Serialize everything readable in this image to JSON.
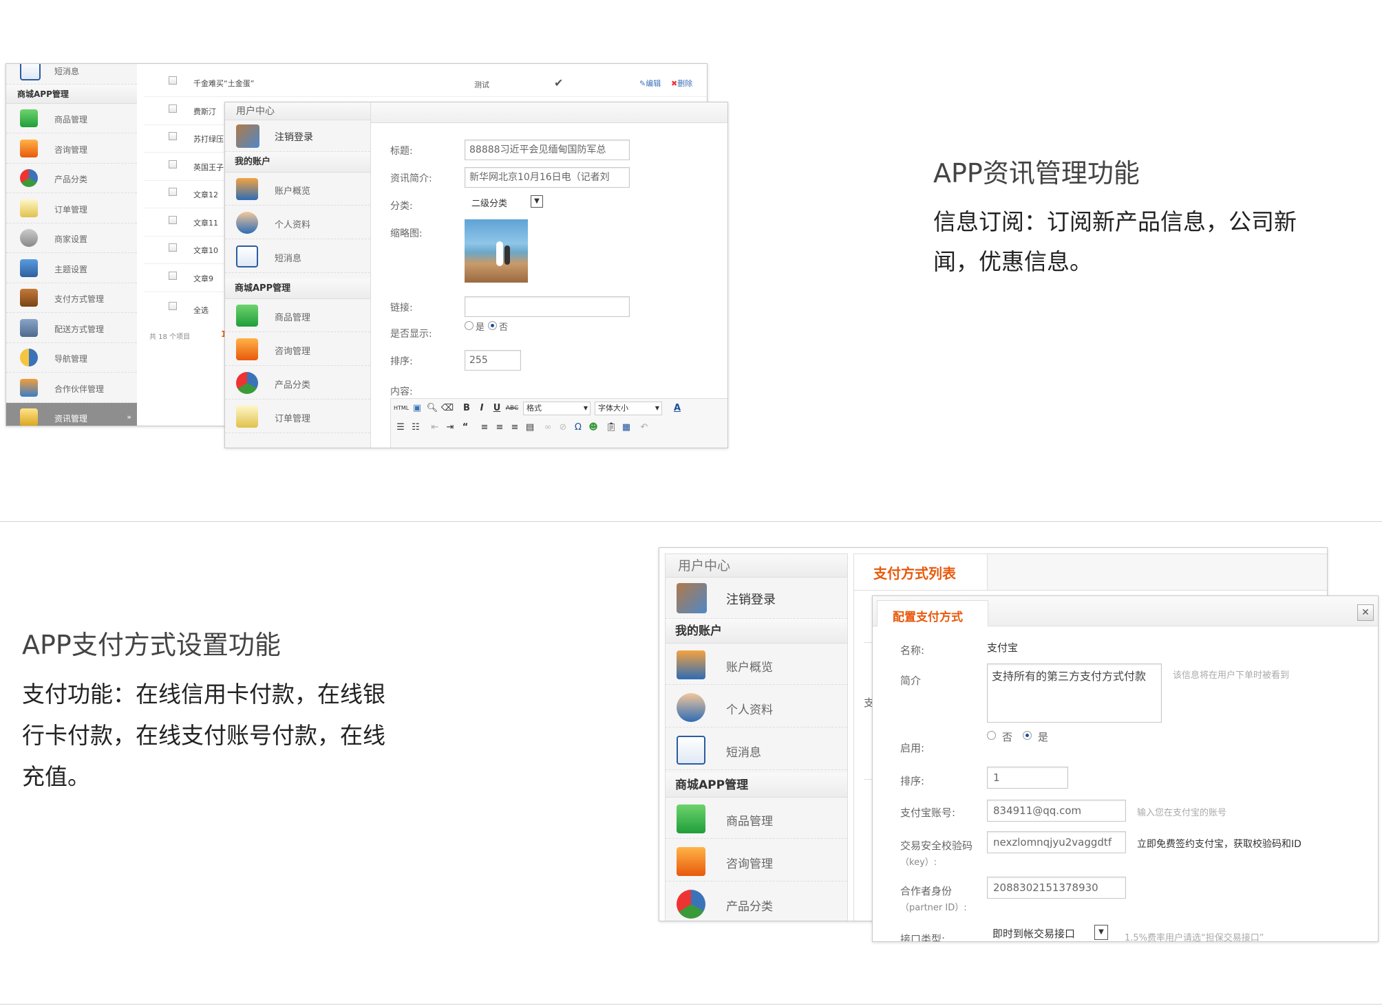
{
  "colors": {
    "accent": "#e8590c",
    "brand_blue": "#1a4f9e",
    "sidebar_active": "#8e8e8e"
  },
  "feature1": {
    "title": "APP资讯管理功能",
    "desc_line1": "信息订阅：订阅新产品信息，公司新",
    "desc_line2": "闻，优惠信息。"
  },
  "feature2": {
    "title": "APP支付方式设置功能",
    "desc_line1": "支付功能：在线信用卡付款，在线银",
    "desc_line2": "行卡付款，在线支付账号付款，在线",
    "desc_line3": "充值。"
  },
  "shot1": {
    "back": {
      "top_item": "短消息",
      "section": "商城APP管理",
      "menu": [
        "商品管理",
        "咨询管理",
        "产品分类",
        "订单管理",
        "商家设置",
        "主题设置",
        "支付方式管理",
        "配送方式管理",
        "导航管理",
        "合作伙伴管理",
        "资讯管理"
      ],
      "rows": [
        "千金难买“土金蛋”",
        "费斯汀",
        "苏打绿压",
        "英国王子",
        "文章12",
        "文章11",
        "文章10",
        "文章9"
      ],
      "row1_cat": "测试",
      "edit": "编辑",
      "del": "删除",
      "select_all": "全选",
      "pager": "共 18 个项目",
      "page": "1"
    },
    "front": {
      "header": "用户中心",
      "logout": "注销登录",
      "my_account": "我的账户",
      "account_items": [
        "账户概览",
        "个人资料",
        "短消息"
      ],
      "section": "商城APP管理",
      "shop_items": [
        "商品管理",
        "咨询管理",
        "产品分类",
        "订单管理"
      ],
      "form": {
        "title_label": "标题:",
        "title_value": "88888习近平会见缅甸国防军总",
        "summary_label": "资讯简介:",
        "summary_value": "新华网北京10月16日电（记者刘",
        "category_label": "分类:",
        "category_value": "二级分类",
        "thumb_label": "缩略图:",
        "link_label": "链接:",
        "show_label": "是否显示:",
        "yes": "是",
        "no": "否",
        "order_label": "排序:",
        "order_value": "255",
        "content_label": "内容:",
        "toolbar_format": "格式",
        "toolbar_fontsize": "字体大小"
      }
    }
  },
  "shot2": {
    "sidebar": {
      "header": "用户中心",
      "logout": "注销登录",
      "my_account": "我的账户",
      "account_items": [
        "账户概览",
        "个人资料",
        "短消息"
      ],
      "section": "商城APP管理",
      "shop_items": [
        "商品管理",
        "咨询管理",
        "产品分类"
      ]
    },
    "main_tab": "支付方式列表",
    "main_partial": "支",
    "dialog": {
      "tab": "配置支付方式",
      "close": "✕",
      "name_label": "名称:",
      "name_value": "支付宝",
      "intro_label": "简介",
      "intro_value": "支持所有的第三方支付方式付款",
      "intro_hint": "该信息将在用户下单时被看到",
      "enable_label": "启用:",
      "no": "否",
      "yes": "是",
      "order_label": "排序:",
      "order_value": "1",
      "account_label": "支付宝账号:",
      "account_value": "834911@qq.com",
      "account_hint": "输入您在支付宝的账号",
      "key_label": "交易安全校验码",
      "key_label2": "（key）:",
      "key_value": "nexzlomnqjyu2vaggdtf",
      "key_hint": "立即免费签约支付宝，获取校验码和ID",
      "pid_label": "合作者身份",
      "pid_label2": "（partner ID）:",
      "pid_value": "2088302151378930",
      "iface_label": "接口类型:",
      "iface_value": "即时到帐交易接口",
      "iface_hint": "1.5%费率用户请选“担保交易接口”"
    }
  }
}
